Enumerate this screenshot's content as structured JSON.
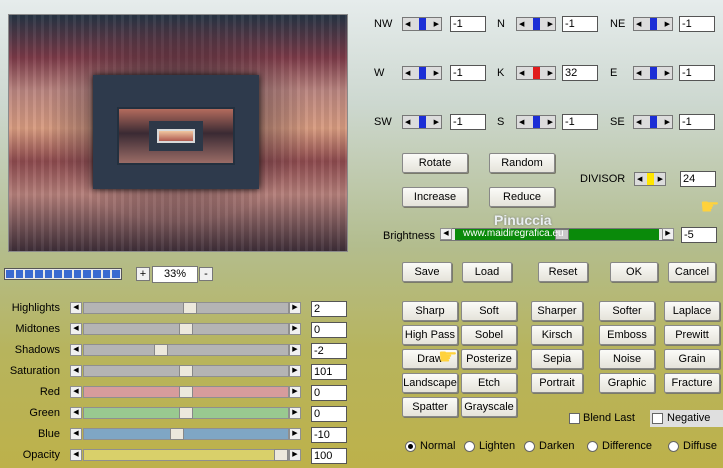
{
  "preview": {
    "alt": ""
  },
  "zoom": {
    "value": "33%",
    "plus": "+",
    "minus": "-"
  },
  "progress_fraction": 1.0,
  "sliders": [
    {
      "label": "Highlights",
      "value": "2",
      "fraction": 0.52,
      "color": "#b4b4b4"
    },
    {
      "label": "Midtones",
      "value": "0",
      "fraction": 0.5,
      "color": "#b4b4b4"
    },
    {
      "label": "Shadows",
      "value": "-2",
      "fraction": 0.37,
      "color": "#b4b4b4"
    },
    {
      "label": "Saturation",
      "value": "101",
      "fraction": 0.5,
      "color": "#b4b4b4"
    },
    {
      "label": "Red",
      "value": "0",
      "fraction": 0.5,
      "color": "#d79c9c"
    },
    {
      "label": "Green",
      "value": "0",
      "fraction": 0.5,
      "color": "#99c990"
    },
    {
      "label": "Blue",
      "value": "-10",
      "fraction": 0.45,
      "color": "#7fa6c4"
    },
    {
      "label": "Opacity",
      "value": "100",
      "fraction": 1.0,
      "color": "#d9d06a"
    }
  ],
  "directions": [
    {
      "label": "NW",
      "value": "-1",
      "bar": "#1c2ed6"
    },
    {
      "label": "N",
      "value": "-1",
      "bar": "#1c2ed6"
    },
    {
      "label": "NE",
      "value": "-1",
      "bar": "#1c2ed6"
    },
    {
      "label": "W",
      "value": "-1",
      "bar": "#1c2ed6"
    },
    {
      "label": "K",
      "value": "32",
      "bar": "#e11c1c"
    },
    {
      "label": "E",
      "value": "-1",
      "bar": "#1c2ed6"
    },
    {
      "label": "SW",
      "value": "-1",
      "bar": "#1c2ed6"
    },
    {
      "label": "S",
      "value": "-1",
      "bar": "#1c2ed6"
    },
    {
      "label": "SE",
      "value": "-1",
      "bar": "#1c2ed6"
    }
  ],
  "buttons": {
    "rotate": "Rotate",
    "random": "Random",
    "increase": "Increase",
    "reduce": "Reduce",
    "save": "Save",
    "load": "Load",
    "reset": "Reset",
    "ok": "OK",
    "cancel": "Cancel"
  },
  "divisor": {
    "label": "DIVISOR",
    "value": "24",
    "bar": "#ffe600"
  },
  "brightness": {
    "label": "Brightness",
    "value": "-5",
    "watermark": "www.maidiregrafica.eu",
    "watermark_name": "Pinuccia",
    "fraction": 0.5,
    "fill": "#0a8a0a"
  },
  "effects": [
    "Sharp",
    "Soft",
    "Sharper",
    "Softer",
    "Laplace",
    "High Pass",
    "Sobel",
    "Kirsch",
    "Emboss",
    "Prewitt",
    "Draw",
    "Posterize",
    "Sepia",
    "Noise",
    "Grain",
    "Landscape",
    "Etch",
    "Portrait",
    "Graphic",
    "Fracture",
    "Spatter",
    "Grayscale"
  ],
  "checks": {
    "blend_last": "Blend Last",
    "negative": "Negative"
  },
  "modes": [
    {
      "label": "Normal",
      "selected": true
    },
    {
      "label": "Lighten",
      "selected": false
    },
    {
      "label": "Darken",
      "selected": false
    },
    {
      "label": "Difference",
      "selected": false
    },
    {
      "label": "Diffuse",
      "selected": false
    }
  ],
  "colors": {
    "accent": "#3a6ad0"
  },
  "icons": [
    "hand-pointer-icon",
    "arrow-left-icon",
    "arrow-right-icon"
  ]
}
